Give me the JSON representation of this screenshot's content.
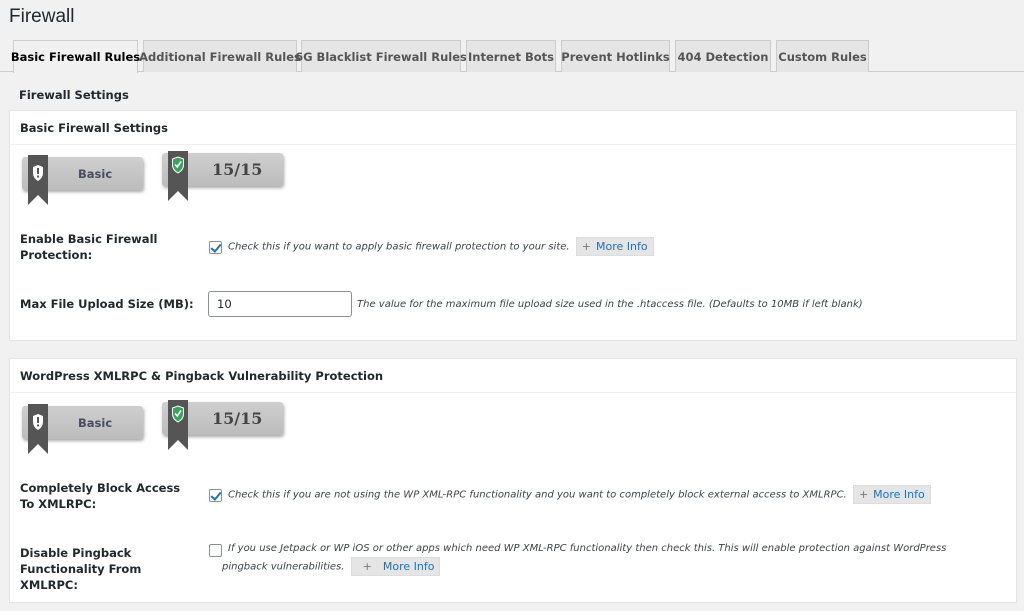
{
  "page": {
    "title": "Firewall"
  },
  "tabs": [
    {
      "label": "Basic Firewall Rules",
      "active": true
    },
    {
      "label": "Additional Firewall Rules",
      "active": false
    },
    {
      "label": "6G Blacklist Firewall Rules",
      "active": false
    },
    {
      "label": "Internet Bots",
      "active": false
    },
    {
      "label": "Prevent Hotlinks",
      "active": false
    },
    {
      "label": "404 Detection",
      "active": false
    },
    {
      "label": "Custom Rules",
      "active": false
    }
  ],
  "section_label": "Firewall Settings",
  "more_info_label": "More Info",
  "colors": {
    "accent": "#2271b1",
    "badge_shield_ok": "#3aa35b",
    "ribbon": "#555555"
  },
  "basic_settings": {
    "header": "Basic Firewall Settings",
    "badge_level": "Basic",
    "badge_score": "15/15",
    "enable": {
      "label": "Enable Basic Firewall Protection:",
      "checked": true,
      "description": "Check this if you want to apply basic firewall protection to your site."
    },
    "max_upload": {
      "label": "Max File Upload Size (MB):",
      "value": "10",
      "description": "The value for the maximum file upload size used in the .htaccess file. (Defaults to 10MB if left blank)"
    }
  },
  "xmlrpc": {
    "header": "WordPress XMLRPC & Pingback Vulnerability Protection",
    "badge_level": "Basic",
    "badge_score": "15/15",
    "block_access": {
      "label": "Completely Block Access To XMLRPC:",
      "checked": true,
      "description": "Check this if you are not using the WP XML-RPC functionality and you want to completely block external access to XMLRPC."
    },
    "disable_pingback": {
      "label": "Disable Pingback Functionality From XMLRPC:",
      "checked": false,
      "description": "If you use Jetpack or WP iOS or other apps which need WP XML-RPC functionality then check this. This will enable protection against WordPress pingback vulnerabilities."
    }
  }
}
